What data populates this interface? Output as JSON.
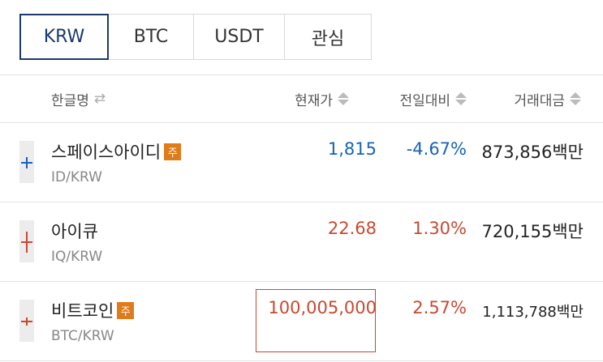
{
  "tabs": [
    {
      "label": "KRW",
      "active": true
    },
    {
      "label": "BTC",
      "active": false
    },
    {
      "label": "USDT",
      "active": false
    },
    {
      "label": "관심",
      "active": false
    }
  ],
  "table_header": {
    "name": "한글명",
    "name_sort_icon": "swap-arrows-icon",
    "price": "현재가",
    "change": "전일대비",
    "volume": "거래대금",
    "sort_icon": "sort-updown-icon"
  },
  "rows": [
    {
      "name": "스페이스아이디",
      "badge": "주",
      "pair": "ID/KRW",
      "price": "1,815",
      "change": "-4.67%",
      "volume": "873,856백만",
      "direction": "down",
      "color": "#1763b6"
    },
    {
      "name": "아이큐",
      "badge": "",
      "pair": "IQ/KRW",
      "price": "22.68",
      "change": "1.30%",
      "volume": "720,155백만",
      "direction": "up",
      "color": "#c84a31"
    },
    {
      "name": "비트코인",
      "badge": "주",
      "pair": "BTC/KRW",
      "price": "100,005,000",
      "change": "2.57%",
      "volume": "1,113,788백만",
      "direction": "up",
      "color": "#c84a31"
    }
  ],
  "colors": {
    "accent": "#1b3a6b",
    "rise": "#c84a31",
    "fall": "#1763b6",
    "badge": "#e07b1a"
  }
}
